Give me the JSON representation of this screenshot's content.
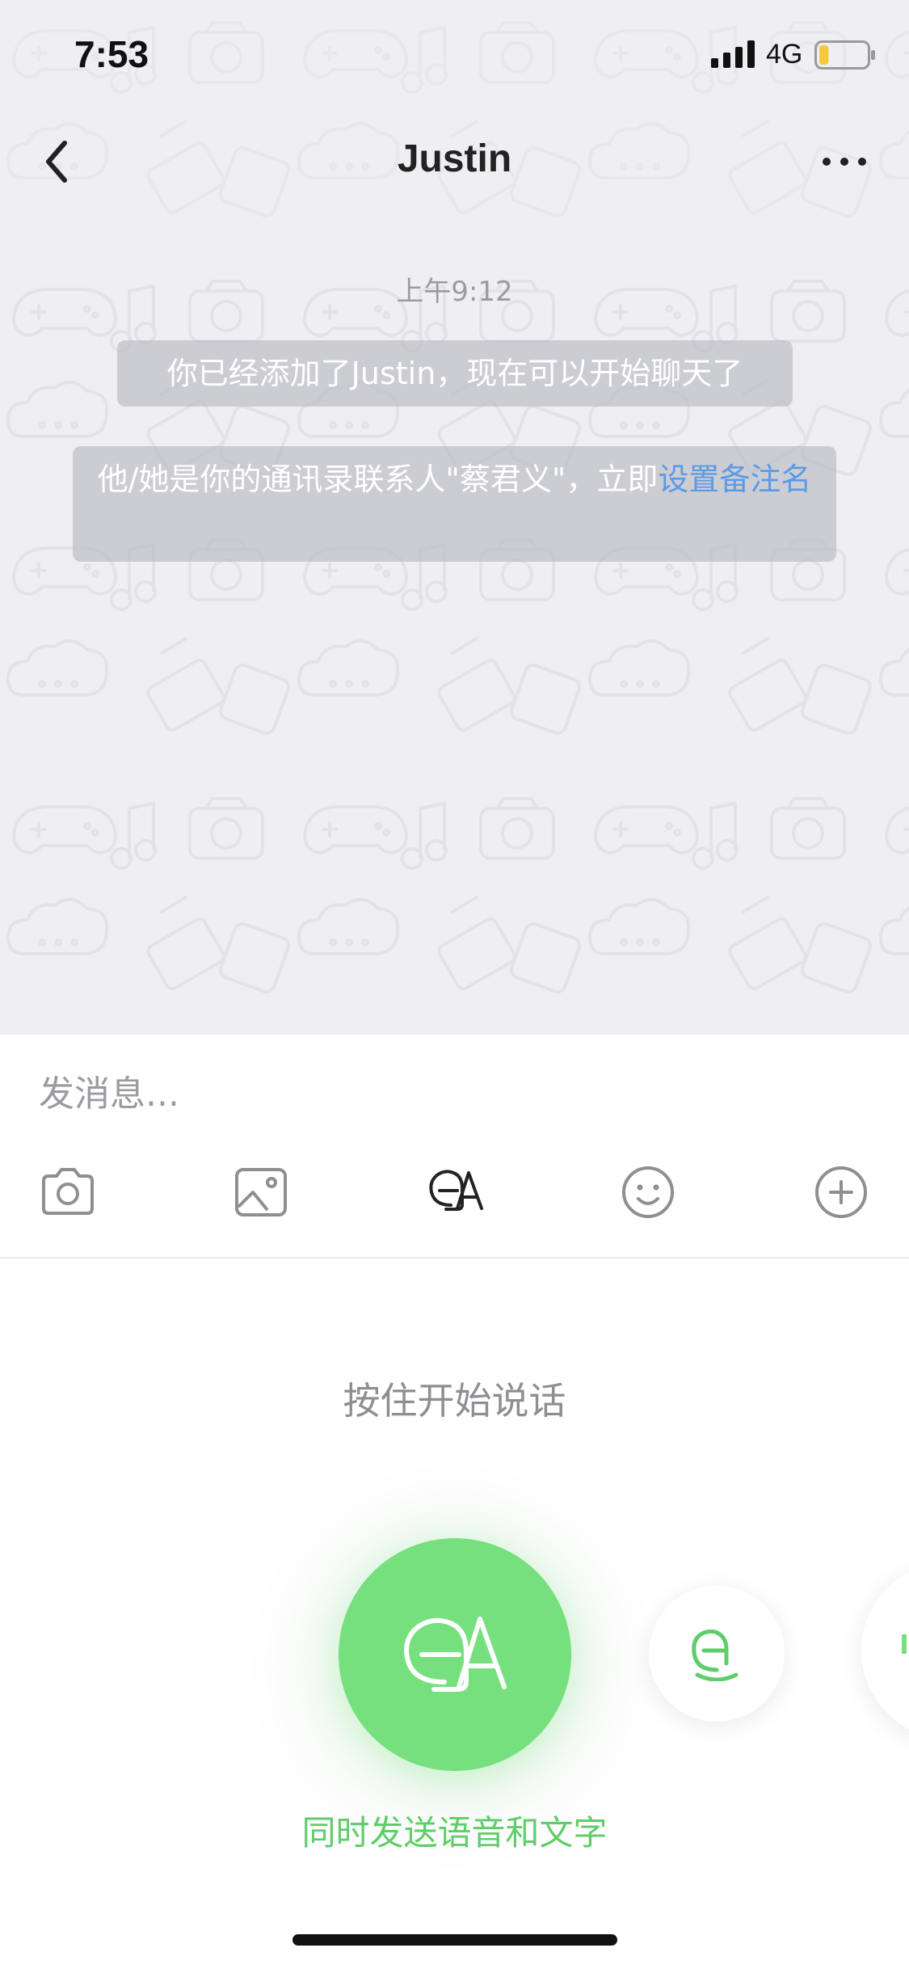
{
  "status_bar": {
    "time": "7:53",
    "network": "4G",
    "battery_level": 0.2,
    "battery_color": "#f5c93a"
  },
  "nav": {
    "title": "Justin",
    "back_icon": "chevron-left-icon",
    "more_icon": "more-dots-icon"
  },
  "chat": {
    "timestamp": "上午9:12",
    "system_messages": [
      {
        "text": "你已经添加了Justin，现在可以开始聊天了"
      },
      {
        "text": "他/她是你的通讯录联系人\"蔡君义\"，立即",
        "link": "设置备注名"
      }
    ]
  },
  "input": {
    "placeholder": "发消息..."
  },
  "toolbar": {
    "items": [
      {
        "name": "camera",
        "icon": "camera-icon"
      },
      {
        "name": "gallery",
        "icon": "image-icon"
      },
      {
        "name": "voice-to-text",
        "icon": "voice-text-icon"
      },
      {
        "name": "emoji",
        "icon": "smiley-icon"
      },
      {
        "name": "more",
        "icon": "plus-circle-icon"
      }
    ]
  },
  "voice_panel": {
    "hint": "按住开始说话",
    "mode_label": "同时发送语音和文字",
    "accent_color": "#76e07f"
  }
}
